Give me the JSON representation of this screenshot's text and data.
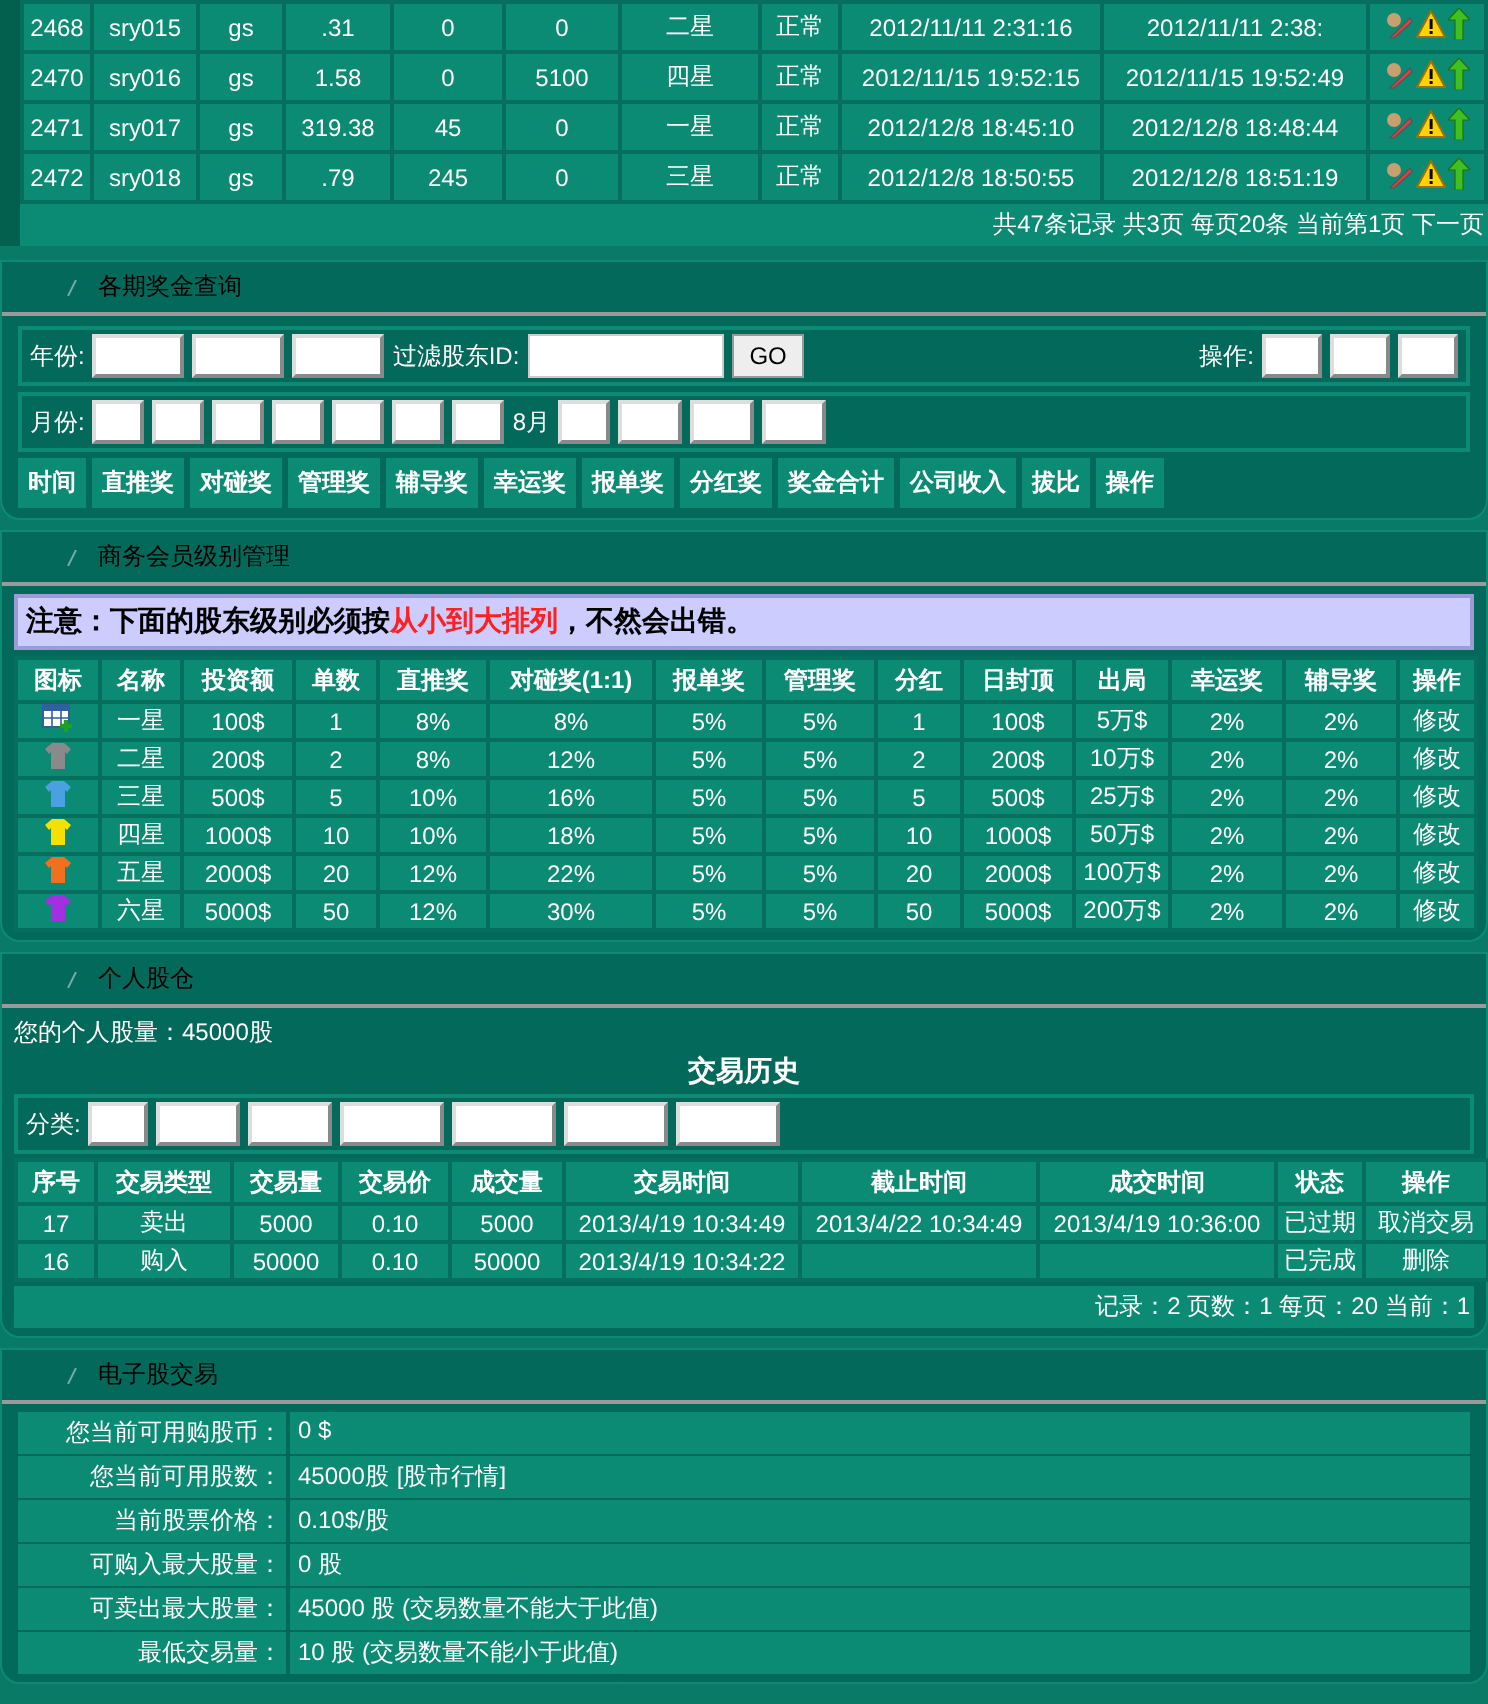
{
  "member_table": {
    "rows": [
      {
        "cells": [
          "2468",
          "sry015",
          "gs",
          ".31",
          "0",
          "0",
          "二星",
          "正常",
          "2012/11/11 2:31:16",
          "2012/11/11 2:38:"
        ]
      },
      {
        "cells": [
          "2470",
          "sry016",
          "gs",
          "1.58",
          "0",
          "5100",
          "四星",
          "正常",
          "2012/11/15 19:52:15",
          "2012/11/15 19:52:49"
        ]
      },
      {
        "cells": [
          "2471",
          "sry017",
          "gs",
          "319.38",
          "45",
          "0",
          "一星",
          "正常",
          "2012/12/8 18:45:10",
          "2012/12/8 18:48:44"
        ]
      },
      {
        "cells": [
          "2472",
          "sry018",
          "gs",
          ".79",
          "245",
          "0",
          "三星",
          "正常",
          "2012/12/8 18:50:55",
          "2012/12/8 18:51:19"
        ]
      }
    ],
    "pager": "共47条记录 共3页 每页20条 当前第1页 下一页"
  },
  "bonus_query": {
    "title": "各期奖金查询",
    "year_label": "年份:",
    "filter_label": "过滤股东ID:",
    "go_button": "GO",
    "action_label": "操作:",
    "month_label": "月份:",
    "month_text": "8月",
    "columns": [
      "时间",
      "直推奖",
      "对碰奖",
      "管理奖",
      "辅导奖",
      "幸运奖",
      "报单奖",
      "分红奖",
      "奖金合计",
      "公司收入",
      "拔比",
      "操作"
    ]
  },
  "level_table": {
    "title": "商务会员级别管理",
    "notice_before": "注意：下面的股东级别必须按",
    "notice_highlight": "从小到大排列",
    "notice_after": "，不然会出错。",
    "columns": [
      "图标",
      "名称",
      "投资额",
      "单数",
      "直推奖",
      "对碰奖(1:1)",
      "报单奖",
      "管理奖",
      "分红",
      "日封顶",
      "出局",
      "幸运奖",
      "辅导奖",
      "操作"
    ],
    "rows": [
      {
        "kind": "table",
        "cells": [
          "",
          "一星",
          "100$",
          "1",
          "8%",
          "8%",
          "5%",
          "5%",
          "1",
          "100$",
          "5万$",
          "2%",
          "2%"
        ],
        "action": "修改"
      },
      {
        "kind": "shirt",
        "color": "#8a8a8a",
        "cells": [
          "",
          "二星",
          "200$",
          "2",
          "8%",
          "12%",
          "5%",
          "5%",
          "2",
          "200$",
          "10万$",
          "2%",
          "2%"
        ],
        "action": "修改"
      },
      {
        "kind": "shirt",
        "color": "#4aa0e0",
        "cells": [
          "",
          "三星",
          "500$",
          "5",
          "10%",
          "16%",
          "5%",
          "5%",
          "5",
          "500$",
          "25万$",
          "2%",
          "2%"
        ],
        "action": "修改"
      },
      {
        "kind": "shirt",
        "color": "#f5e000",
        "cells": [
          "",
          "四星",
          "1000$",
          "10",
          "10%",
          "18%",
          "5%",
          "5%",
          "10",
          "1000$",
          "50万$",
          "2%",
          "2%"
        ],
        "action": "修改"
      },
      {
        "kind": "shirt",
        "color": "#f07020",
        "cells": [
          "",
          "五星",
          "2000$",
          "20",
          "12%",
          "22%",
          "5%",
          "5%",
          "20",
          "2000$",
          "100万$",
          "2%",
          "2%"
        ],
        "action": "修改"
      },
      {
        "kind": "shirt",
        "color": "#a030e0",
        "cells": [
          "",
          "六星",
          "5000$",
          "50",
          "12%",
          "30%",
          "5%",
          "5%",
          "50",
          "5000$",
          "200万$",
          "2%",
          "2%"
        ],
        "action": "修改"
      }
    ]
  },
  "holdings": {
    "title": "个人股仓",
    "amount_text": "您的个人股量：45000股",
    "history_title": "交易历史",
    "category_label": "分类:",
    "columns": [
      "序号",
      "交易类型",
      "交易量",
      "交易价",
      "成交量",
      "交易时间",
      "截止时间",
      "成交时间",
      "状态",
      "操作"
    ],
    "rows": [
      {
        "cells": [
          "17",
          "卖出",
          "5000",
          "0.10",
          "5000",
          "2013/4/19 10:34:49",
          "2013/4/22 10:34:49",
          "2013/4/19 10:36:00",
          "已过期"
        ],
        "action": "取消交易"
      },
      {
        "cells": [
          "16",
          "购入",
          "50000",
          "0.10",
          "50000",
          "2013/4/19 10:34:22",
          "",
          "",
          "已完成"
        ],
        "action": "删除"
      }
    ],
    "footer": "记录：2 页数：1 每页：20 当前：1"
  },
  "trading": {
    "title": "电子股交易",
    "rows": [
      {
        "label": "您当前可用购股币：",
        "value": "0 $"
      },
      {
        "label": "您当前可用股数：",
        "value": "45000股",
        "link": "[股市行情]"
      },
      {
        "label": "当前股票价格：",
        "value": "0.10$/股"
      },
      {
        "label": "可购入最大股量：",
        "value": "0 股"
      },
      {
        "label": "可卖出最大股量：",
        "value": "45000 股 (交易数量不能大于此值)"
      },
      {
        "label": "最低交易量：",
        "value": "10 股 (交易数量不能小于此值)"
      }
    ]
  }
}
